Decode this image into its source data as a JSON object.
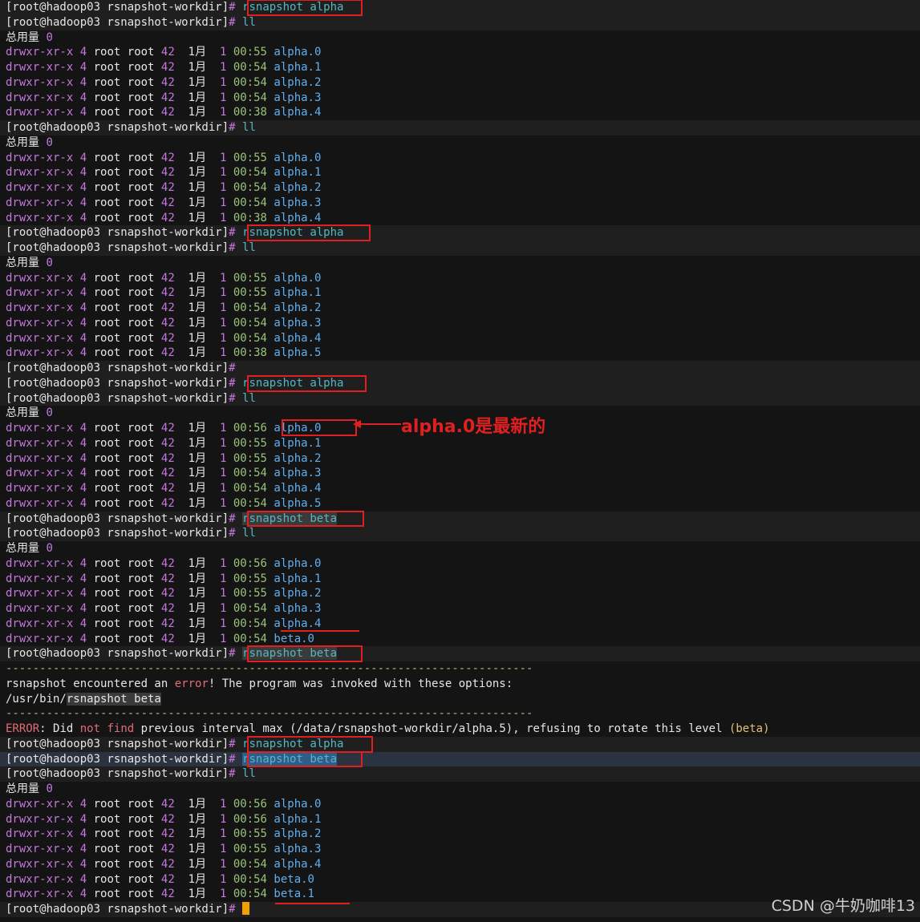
{
  "prompt": "[root@hadoop03 rsnapshot-workdir]",
  "hash": "#",
  "total_label": "总用量",
  "total_value": "0",
  "commands": {
    "alpha": "rsnapshot alpha",
    "beta": "rsnapshot beta",
    "ll": "ll"
  },
  "listing_fields": {
    "perm": "drwxr-xr-x",
    "links": "4",
    "owner": "root",
    "group": "root",
    "size": "42",
    "month": "1月",
    "day": "1"
  },
  "listings": [
    [
      [
        "00:55",
        "alpha.0"
      ],
      [
        "00:54",
        "alpha.1"
      ],
      [
        "00:54",
        "alpha.2"
      ],
      [
        "00:54",
        "alpha.3"
      ],
      [
        "00:38",
        "alpha.4"
      ]
    ],
    [
      [
        "00:55",
        "alpha.0"
      ],
      [
        "00:54",
        "alpha.1"
      ],
      [
        "00:54",
        "alpha.2"
      ],
      [
        "00:54",
        "alpha.3"
      ],
      [
        "00:38",
        "alpha.4"
      ]
    ],
    [
      [
        "00:55",
        "alpha.0"
      ],
      [
        "00:55",
        "alpha.1"
      ],
      [
        "00:54",
        "alpha.2"
      ],
      [
        "00:54",
        "alpha.3"
      ],
      [
        "00:54",
        "alpha.4"
      ],
      [
        "00:38",
        "alpha.5"
      ]
    ],
    [
      [
        "00:56",
        "alpha.0"
      ],
      [
        "00:55",
        "alpha.1"
      ],
      [
        "00:55",
        "alpha.2"
      ],
      [
        "00:54",
        "alpha.3"
      ],
      [
        "00:54",
        "alpha.4"
      ],
      [
        "00:54",
        "alpha.5"
      ]
    ],
    [
      [
        "00:56",
        "alpha.0"
      ],
      [
        "00:55",
        "alpha.1"
      ],
      [
        "00:55",
        "alpha.2"
      ],
      [
        "00:54",
        "alpha.3"
      ],
      [
        "00:54",
        "alpha.4"
      ],
      [
        "00:54",
        "beta.0"
      ]
    ],
    [
      [
        "00:56",
        "alpha.0"
      ],
      [
        "00:56",
        "alpha.1"
      ],
      [
        "00:55",
        "alpha.2"
      ],
      [
        "00:55",
        "alpha.3"
      ],
      [
        "00:54",
        "alpha.4"
      ],
      [
        "00:54",
        "beta.0"
      ],
      [
        "00:54",
        "beta.1"
      ]
    ]
  ],
  "error_block": {
    "rule": "------------------------------------------------------------------------------",
    "msg_pre": "rsnapshot encountered an ",
    "msg_err": "error",
    "msg_post": "! The program was invoked with these options:",
    "invoked_path": "/usr/bin/",
    "invoked_cmd": "rsnapshot beta",
    "err_label": "ERROR",
    "err_1": ": Did ",
    "err_not": "not",
    "err_2": " ",
    "err_find": "find",
    "err_3": " previous interval max ",
    "err_path": "(/data/rsnapshot-workdir/alpha.5)",
    "err_4": ", refusing to rotate this level ",
    "err_level": "(beta)"
  },
  "annotation": "alpha.0是最新的",
  "watermark": "CSDN @牛奶咖啡13",
  "colors": {
    "annotation": "#e02020",
    "cursor": "#f0a000"
  }
}
